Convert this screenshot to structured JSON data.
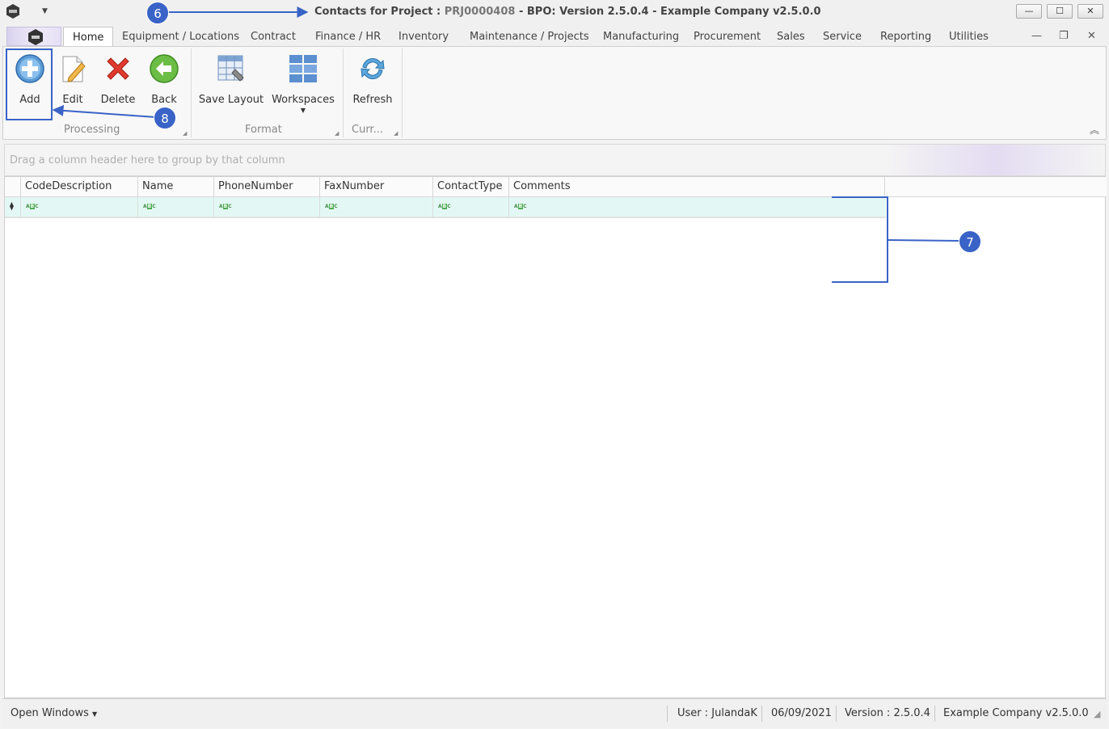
{
  "window": {
    "title_prefix": "Contacts for Project : ",
    "project_code": "PRJ0000408",
    "title_suffix": " - BPO: Version 2.5.0.4 - Example Company v2.5.0.0",
    "minimize": "—",
    "maximize": "☐",
    "close": "✕"
  },
  "tabs": [
    "Home",
    "Equipment / Locations",
    "Contract",
    "Finance / HR",
    "Inventory",
    "Maintenance / Projects",
    "Manufacturing",
    "Procurement",
    "Sales",
    "Service",
    "Reporting",
    "Utilities"
  ],
  "ribbon": {
    "add": "Add",
    "edit": "Edit",
    "delete": "Delete",
    "back": "Back",
    "save_layout": "Save Layout",
    "workspaces": "Workspaces",
    "refresh": "Refresh",
    "group_processing": "Processing",
    "group_format": "Format",
    "group_current": "Curr..."
  },
  "grid": {
    "group_panel_hint": "Drag a column header here to group by that column",
    "columns": [
      "CodeDescription",
      "Name",
      "PhoneNumber",
      "FaxNumber",
      "ContactType",
      "Comments"
    ]
  },
  "statusbar": {
    "open_windows": "Open Windows",
    "user": "User : JulandaK",
    "date": "06/09/2021",
    "version": "Version : 2.5.0.4",
    "company": "Example Company v2.5.0.0"
  },
  "annotations": {
    "badge_6": "6",
    "badge_7": "7",
    "badge_8": "8"
  },
  "colors": {
    "annotation": "#3a63c7",
    "filter_row": "#e3f8f4"
  }
}
